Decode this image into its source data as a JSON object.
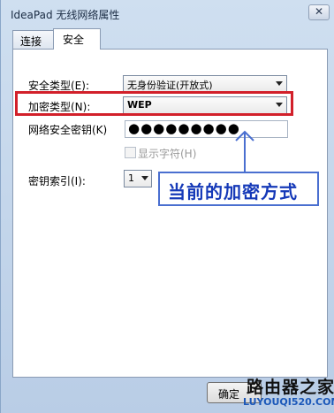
{
  "window": {
    "title": "IdeaPad 无线网络属性",
    "close_label": "✕"
  },
  "tabs": [
    {
      "label": "连接"
    },
    {
      "label": "安全"
    }
  ],
  "form": {
    "security_type_label": "安全类型(E):",
    "security_type_value": "无身份验证(开放式)",
    "encryption_type_label": "加密类型(N):",
    "encryption_type_value": "WEP",
    "network_key_label": "网络安全密钥(K)",
    "network_key_value": "●●●●●●●●●",
    "show_chars_label": "显示字符(H)",
    "key_index_label": "密钥索引(I):",
    "key_index_value": "1"
  },
  "annotation": {
    "callout_text": "当前的加密方式",
    "highlight_color": "#d2202a",
    "callout_color": "#1539b8"
  },
  "buttons": {
    "ok_label": "确定"
  },
  "watermark": {
    "logo": "路由器之家",
    "url": "LUYOUQI520.COM"
  }
}
